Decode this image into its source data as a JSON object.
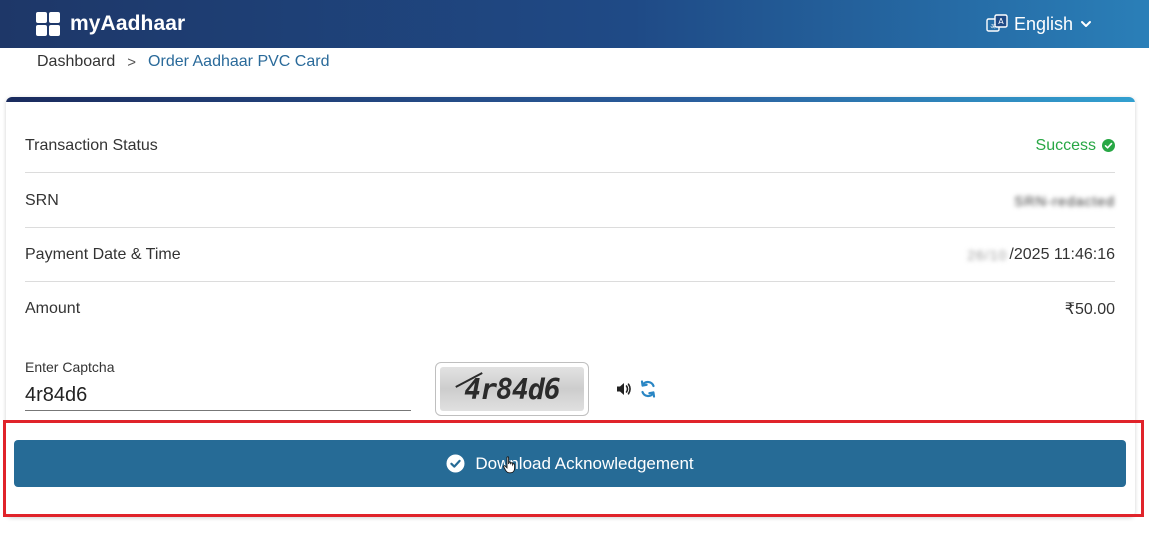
{
  "header": {
    "brand": "myAadhaar",
    "language": "English",
    "icons": {
      "logo": "grid-logo-icon",
      "language": "translate-icon",
      "dropdown": "chevron-down-icon"
    }
  },
  "breadcrumb": {
    "home": "Dashboard",
    "separator": ">",
    "current": "Order Aadhaar PVC Card"
  },
  "details": {
    "rows": [
      {
        "label": "Transaction Status",
        "value": "Success"
      },
      {
        "label": "SRN",
        "value": "SRN-redacted"
      },
      {
        "label": "Payment Date & Time",
        "value_hidden": "26/10",
        "value_visible": "/2025 11:46:16"
      },
      {
        "label": "Amount",
        "value": "₹50.00"
      }
    ]
  },
  "captcha": {
    "label": "Enter Captcha",
    "value": "4r84d6",
    "image_text": "4r84d6",
    "icons": {
      "audio": "speaker-icon",
      "refresh": "refresh-icon"
    }
  },
  "actions": {
    "download_label": "Download Acknowledgement",
    "download_icon": "check-circle-icon"
  },
  "colors": {
    "header_start": "#1e3768",
    "header_end": "#2a7fb8",
    "success": "#28a745",
    "button": "#266b96",
    "highlight": "#e0232a",
    "link": "#2a6a9a"
  }
}
